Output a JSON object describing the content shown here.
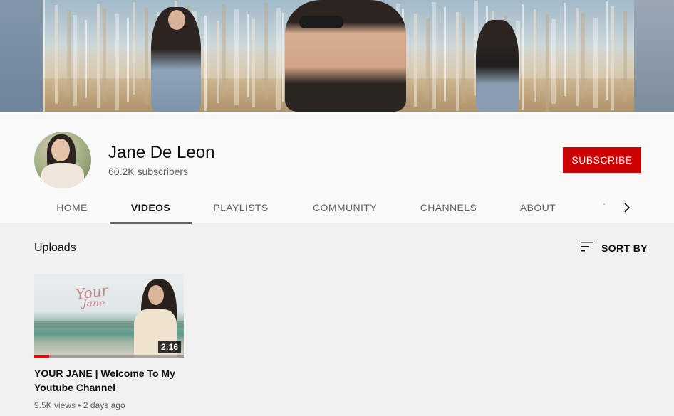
{
  "channel": {
    "name": "Jane De Leon",
    "subscribers": "60.2K subscribers",
    "subscribe_label": "SUBSCRIBE"
  },
  "tabs": [
    {
      "label": "HOME"
    },
    {
      "label": "VIDEOS"
    },
    {
      "label": "PLAYLISTS"
    },
    {
      "label": "COMMUNITY"
    },
    {
      "label": "CHANNELS"
    },
    {
      "label": "ABOUT"
    }
  ],
  "active_tab": "VIDEOS",
  "section": {
    "title": "Uploads",
    "sort_label": "SORT BY"
  },
  "videos": [
    {
      "title": "YOUR JANE | Welcome To My Youtube Channel",
      "duration": "2:16",
      "views": "9.5K views",
      "age": "2 days ago",
      "watch_progress": 0.1,
      "thumbnail_text": [
        "Your",
        "Jane"
      ]
    }
  ],
  "colors": {
    "subscribe": "#cc0000",
    "progress": "#ff0000",
    "text_secondary": "#606060"
  },
  "icons": {
    "sort": "sort-lines-icon",
    "tabs_next": "chevron-right-icon"
  }
}
